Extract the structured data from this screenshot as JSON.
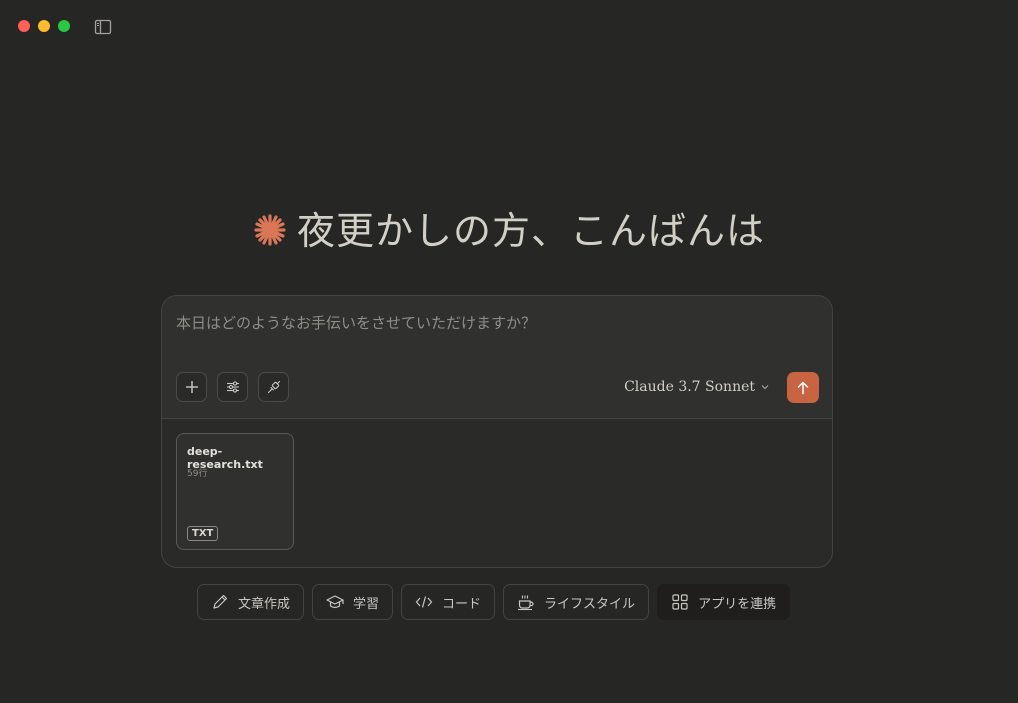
{
  "window": {
    "traffic_lights": [
      "close",
      "minimize",
      "zoom"
    ],
    "sidebar_toggle_icon": "sidebar-icon"
  },
  "greeting": {
    "logo_icon": "claude-spark-icon",
    "text": "夜更かしの方、こんばんは"
  },
  "composer": {
    "placeholder": "本日はどのようなお手伝いをさせていただけますか？",
    "tools": [
      {
        "name": "add",
        "icon": "plus-icon"
      },
      {
        "name": "settings",
        "icon": "sliders-icon"
      },
      {
        "name": "integrations",
        "icon": "plug-icon"
      }
    ],
    "model": "Claude 3.7 Sonnet",
    "send_icon": "arrow-up-icon"
  },
  "attachment": {
    "filename": "deep-research.txt",
    "lines": "59行",
    "type_badge": "TXT"
  },
  "chips": [
    {
      "label": "文章作成",
      "icon": "pencil-icon"
    },
    {
      "label": "学習",
      "icon": "graduation-cap-icon"
    },
    {
      "label": "コード",
      "icon": "code-icon"
    },
    {
      "label": "ライフスタイル",
      "icon": "coffee-icon"
    },
    {
      "label": "アプリを連携",
      "icon": "grid-icon"
    }
  ],
  "colors": {
    "background": "#262624",
    "accent": "#c96442",
    "text": "#c9c7c0"
  }
}
